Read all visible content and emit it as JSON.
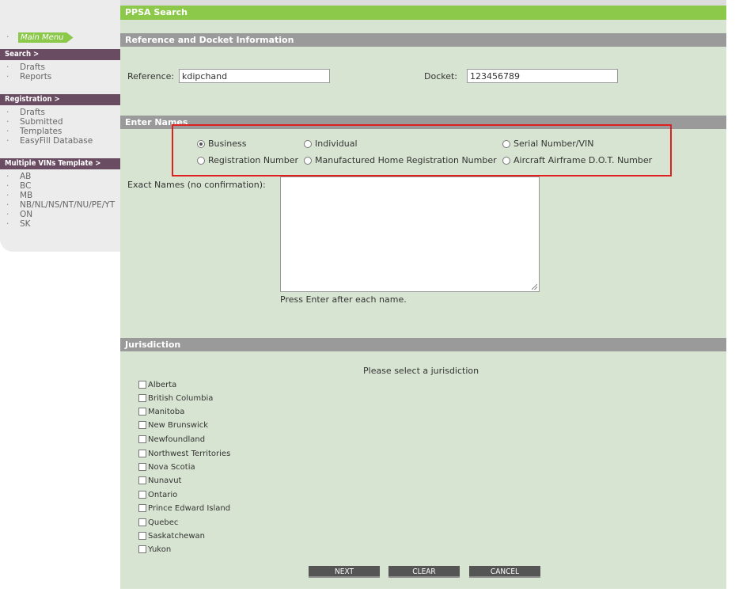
{
  "sidebar": {
    "main_menu": "Main Menu",
    "search": {
      "header": "Search >",
      "items": [
        "Drafts",
        "Reports"
      ]
    },
    "registration": {
      "header": "Registration >",
      "items": [
        "Drafts",
        "Submitted",
        "Templates",
        "EasyFill Database"
      ]
    },
    "vins": {
      "header": "Multiple VINs Template >",
      "items": [
        "AB",
        "BC",
        "MB",
        "NB/NL/NS/NT/NU/PE/YT",
        "ON",
        "SK"
      ]
    }
  },
  "page": {
    "title": "PPSA Search"
  },
  "reference_section": {
    "header": "Reference and Docket Information",
    "reference_label": "Reference:",
    "reference_value": "kdipchand",
    "docket_label": "Docket:",
    "docket_value": "123456789"
  },
  "names_section": {
    "header": "Enter Names",
    "search_types": [
      {
        "label": "Business",
        "selected": true
      },
      {
        "label": "Individual",
        "selected": false
      },
      {
        "label": "Serial Number/VIN",
        "selected": false
      },
      {
        "label": "Registration Number",
        "selected": false
      },
      {
        "label": "Manufactured Home Registration Number",
        "selected": false
      },
      {
        "label": "Aircraft Airframe D.O.T. Number",
        "selected": false
      }
    ],
    "exact_names_label": "Exact Names (no confirmation):",
    "exact_names_value": "",
    "hint": "Press Enter after each name."
  },
  "jurisdiction_section": {
    "header": "Jurisdiction",
    "prompt": "Please select a jurisdiction",
    "options": [
      "Alberta",
      "British Columbia",
      "Manitoba",
      "New Brunswick",
      "Newfoundland",
      "Northwest Territories",
      "Nova Scotia",
      "Nunavut",
      "Ontario",
      "Prince Edward Island",
      "Quebec",
      "Saskatchewan",
      "Yukon"
    ]
  },
  "buttons": {
    "next": "NEXT",
    "clear": "CLEAR",
    "cancel": "CANCEL"
  },
  "colors": {
    "accent_green": "#8cc84a",
    "section_gray": "#9a9a9a",
    "form_bg": "#d8e4d2",
    "sidebar_header": "#6a4c62",
    "highlight": "#e02020"
  }
}
